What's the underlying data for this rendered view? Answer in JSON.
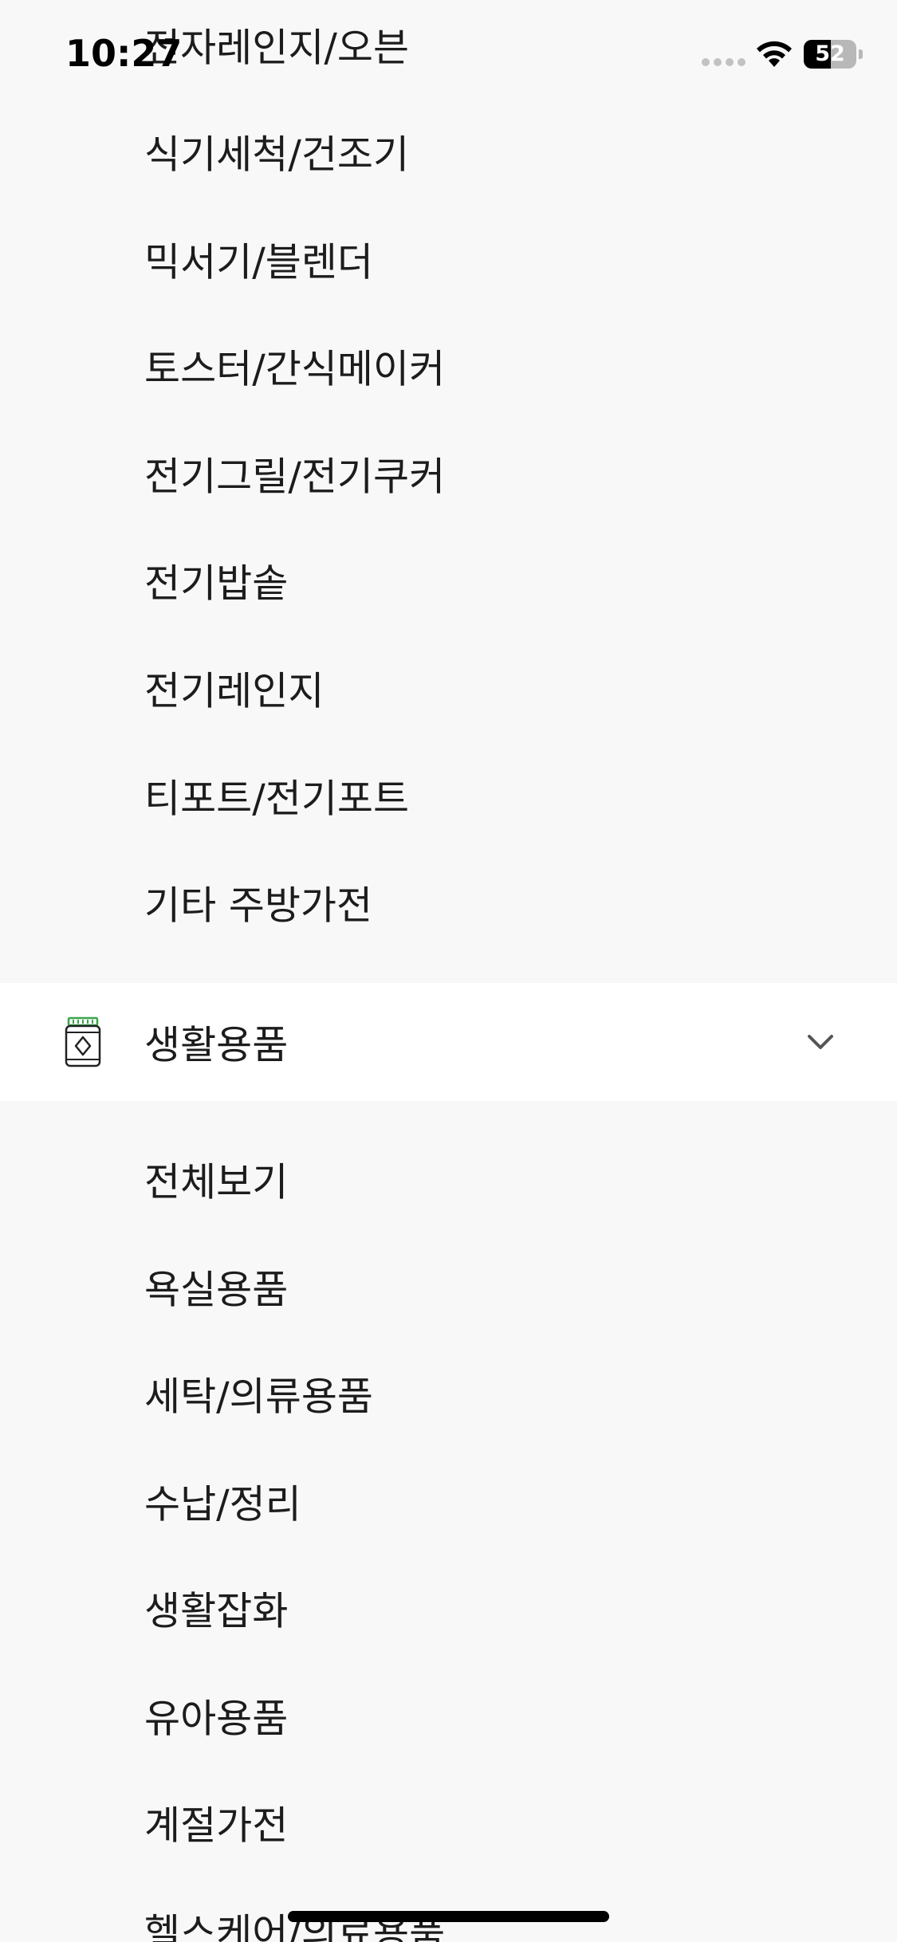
{
  "status_bar": {
    "time": "10:27",
    "battery_level": "52",
    "battery_fraction": 0.52,
    "wifi_icon": "wifi-icon",
    "signal_icon": "cellular-signal-icon"
  },
  "kitchen_items": [
    {
      "label": "전자레인지/오븐"
    },
    {
      "label": "식기세척/건조기"
    },
    {
      "label": "믹서기/블렌더"
    },
    {
      "label": "토스터/간식메이커"
    },
    {
      "label": "전기그릴/전기쿠커"
    },
    {
      "label": "전기밥솥"
    },
    {
      "label": "전기레인지"
    },
    {
      "label": "티포트/전기포트"
    },
    {
      "label": "기타 주방가전"
    }
  ],
  "category": {
    "label": "생활용품",
    "icon": "household-jar-icon",
    "toggle_icon": "chevron-down-icon",
    "icon_accent": "#3aa54a"
  },
  "household_items": [
    {
      "label": "전체보기"
    },
    {
      "label": "욕실용품"
    },
    {
      "label": "세탁/의류용품"
    },
    {
      "label": "수납/정리"
    },
    {
      "label": "생활잡화"
    },
    {
      "label": "유아용품"
    },
    {
      "label": "계절가전"
    },
    {
      "label": "헬스케어/의료용품"
    }
  ],
  "colors": {
    "background": "#f8f8f8",
    "row_highlight": "#ffffff",
    "text": "#1c1c1c",
    "chevron": "#555555"
  }
}
